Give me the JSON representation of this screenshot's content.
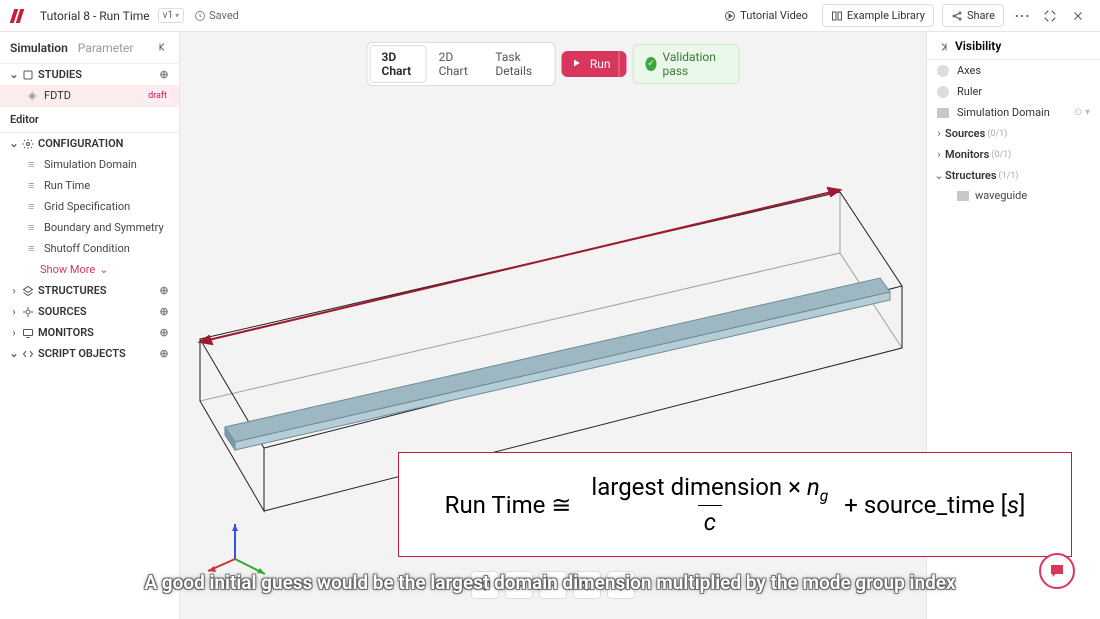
{
  "header": {
    "doc_title": "Tutorial 8 - Run Time",
    "version": "v1",
    "saved_label": "Saved",
    "tutorial_video": "Tutorial Video",
    "example_library": "Example Library",
    "share": "Share"
  },
  "left_panel": {
    "tab_simulation": "Simulation",
    "tab_parameter": "Parameter",
    "studies_label": "STUDIES",
    "fdtd_label": "FDTD",
    "fdtd_badge": "draft",
    "editor_label": "Editor",
    "config_label": "CONFIGURATION",
    "config_items": {
      "sim_domain": "Simulation Domain",
      "run_time": "Run Time",
      "grid_spec": "Grid Specification",
      "boundary": "Boundary and Symmetry",
      "shutoff": "Shutoff Condition"
    },
    "show_more": "Show More",
    "structures_label": "STRUCTURES",
    "sources_label": "SOURCES",
    "monitors_label": "MONITORS",
    "script_objects_label": "SCRIPT OBJECTS"
  },
  "canvas": {
    "tab_3d": "3D Chart",
    "tab_2d": "2D Chart",
    "tab_task": "Task Details",
    "run_label": "Run",
    "validation_label": "Validation pass"
  },
  "formula": {
    "lhs": "Run Time ≅",
    "numerator_text": "largest dimension × ",
    "numerator_var": "n",
    "numerator_sub": "g",
    "denominator": "c",
    "plus": " + source_time [",
    "tail_var": "s",
    "tail_close": "]"
  },
  "right_panel": {
    "visibility_label": "Visibility",
    "axes": "Axes",
    "ruler": "Ruler",
    "sim_domain": "Simulation Domain",
    "sources": "Sources",
    "sources_count": "(0/1)",
    "monitors": "Monitors",
    "monitors_count": "(0/1)",
    "structures": "Structures",
    "structures_count": "(1/1)",
    "waveguide": "waveguide"
  },
  "subtitle": "A good initial guess would be the largest domain dimension multiplied by the mode group index"
}
